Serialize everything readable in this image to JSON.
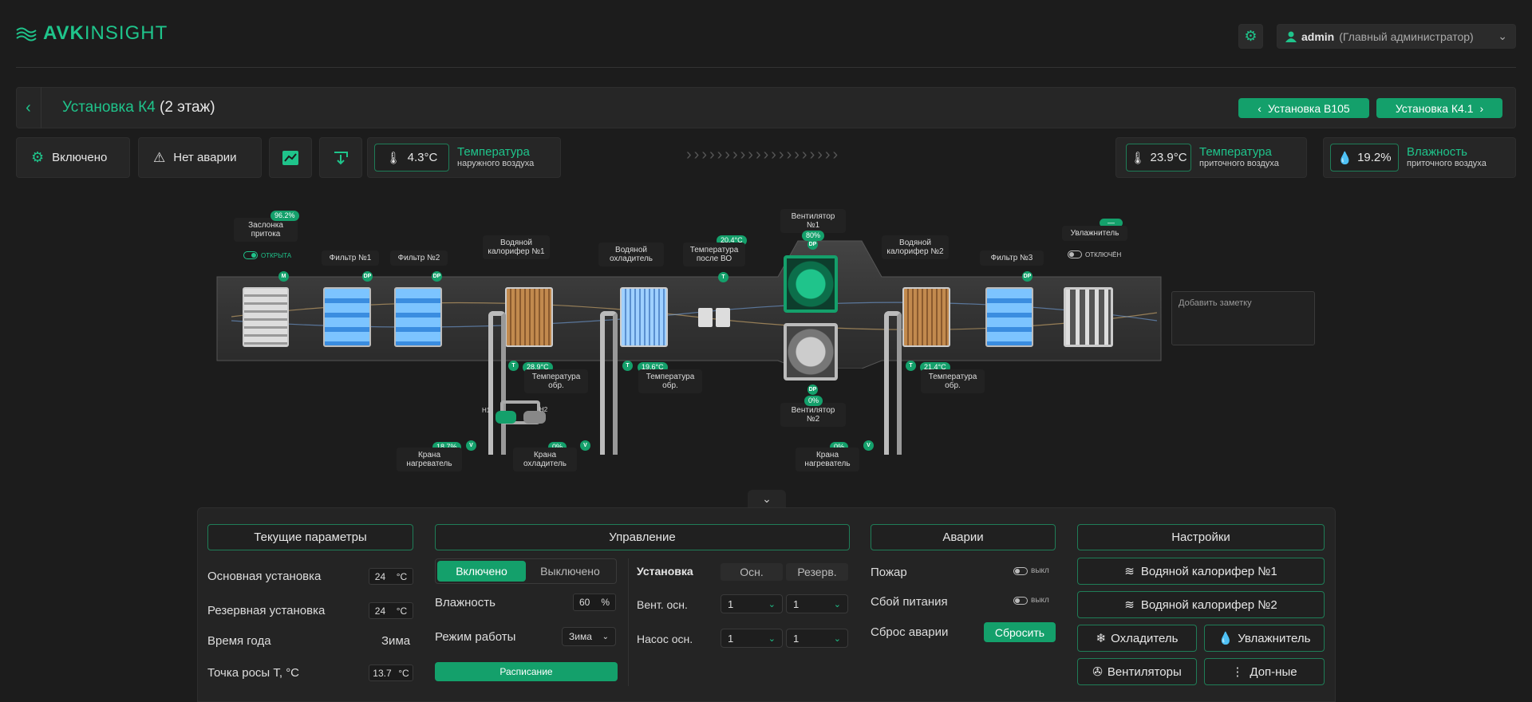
{
  "header": {
    "logo_a": "AVK",
    "logo_b": "INSIGHT",
    "user": "admin",
    "role": "(Главный администратор)"
  },
  "unit": {
    "name": "Установка К4",
    "floor": "(2 этаж)",
    "prev": "Установка В105",
    "next": "Установка К4.1"
  },
  "status": {
    "state": "Включено",
    "alarm": "Нет аварии",
    "outside_temp": "4.3°C",
    "outside_title": "Температура",
    "outside_sub": "наружного воздуха",
    "supply_temp": "23.9°C",
    "supply_title": "Температура",
    "supply_sub": "приточного воздуха",
    "supply_hum": "19.2%",
    "hum_title": "Влажность",
    "hum_sub": "приточного воздуха"
  },
  "scheme": {
    "damper_pct": "96.2%",
    "damper_label": "Заслонка притока",
    "damper_state": "ОТКРЫТА",
    "filter1": "Фильтр №1",
    "filter2": "Фильтр №2",
    "filter3": "Фильтр №3",
    "heater1": "Водяной калорифер №1",
    "cooler": "Водяной охладитель",
    "temp_after": "Температура после ВО",
    "temp_after_val": "20.4°C",
    "fan1": "Вентилятор №1",
    "fan1_val": "80%",
    "fan2": "Вентилятор №2",
    "fan2_val": "0%",
    "heater2": "Водяной калорифер №2",
    "humidifier": "Увлажнитель",
    "hum_val": "—",
    "hum_state": "ОТКЛЮЧЁН",
    "ret1_val": "28.9°C",
    "ret2_val": "19.6°C",
    "ret3_val": "21.4°C",
    "ret_label": "Температура обр.",
    "valve1_val": "18.7%",
    "valve1_label": "Крана нагреватель",
    "valve2_val": "0%",
    "valve2_label": "Крана охладитель",
    "valve3_val": "0%",
    "valve3_label": "Крана нагреватель",
    "pump1": "Н1",
    "pump2": "Н2",
    "note_placeholder": "Добавить заметку"
  },
  "params": {
    "title": "Текущие параметры",
    "rows": [
      {
        "label": "Основная установка",
        "val": "24",
        "unit": "°С"
      },
      {
        "label": "Резервная установка",
        "val": "24",
        "unit": "°С"
      },
      {
        "label": "Время года",
        "val": "Зима"
      },
      {
        "label": "Точка росы Т, °С",
        "val": "13.7",
        "unit": "°С"
      }
    ]
  },
  "control": {
    "title": "Управление",
    "on": "Включено",
    "off": "Выключено",
    "humidity_label": "Влажность",
    "humidity_val": "60",
    "humidity_unit": "%",
    "mode_label": "Режим работы",
    "mode_val": "Зима",
    "schedule": "Расписание",
    "col_install": "Установка",
    "col_main": "Осн.",
    "col_reserve": "Резерв.",
    "fan_label": "Вент. осн.",
    "fan_main": "1",
    "fan_res": "1",
    "pump_label": "Насос осн.",
    "pump_main": "1",
    "pump_res": "1"
  },
  "alarms": {
    "title": "Аварии",
    "fire": "Пожар",
    "fire_state": "выкл",
    "power": "Сбой питания",
    "power_state": "выкл",
    "reset_label": "Сброс аварии",
    "reset_btn": "Сбросить"
  },
  "settings": {
    "title": "Настройки",
    "heater1": "Водяной калорифер №1",
    "heater2": "Водяной калорифер №2",
    "cooler": "Охладитель",
    "humidifier": "Увлажнитель",
    "fans": "Вентиляторы",
    "more": "Доп-ные"
  }
}
